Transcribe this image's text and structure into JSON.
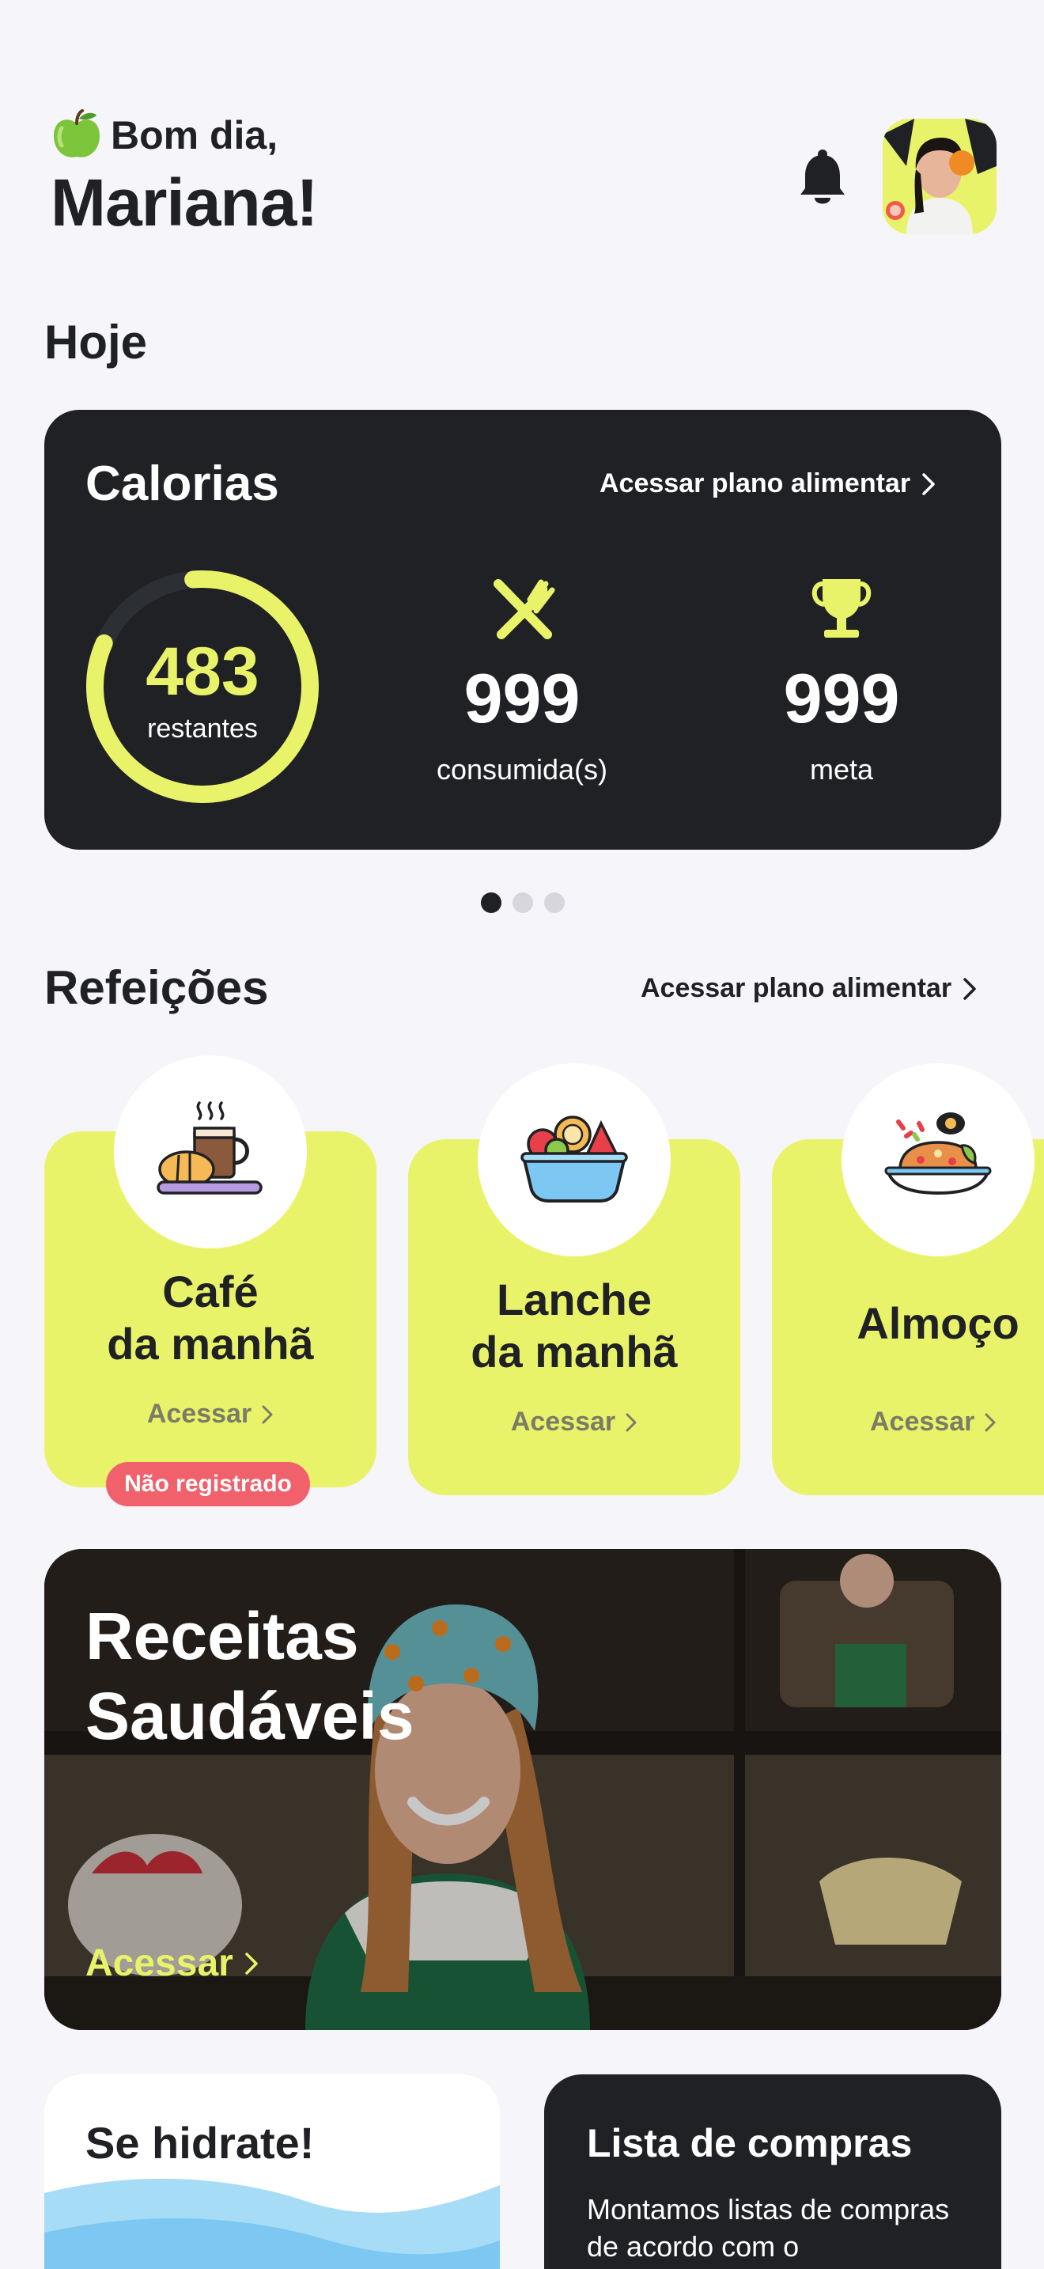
{
  "header": {
    "greeting": "Bom dia,",
    "name": "Mariana!",
    "greeting_icon": "green-apple-icon",
    "notification_icon": "bell-icon"
  },
  "today": {
    "section_title": "Hoje",
    "calories": {
      "title": "Calorias",
      "link": "Acessar plano alimentar",
      "remaining_value": "483",
      "remaining_label": "restantes",
      "remaining_fraction": 0.83,
      "consumed_value": "999",
      "consumed_label": "consumida(s)",
      "goal_value": "999",
      "goal_label": "meta"
    },
    "carousel": {
      "pages": 3,
      "active": 1
    }
  },
  "meals": {
    "section_title": "Refeições",
    "link": "Acessar plano alimentar",
    "items": [
      {
        "title_line1": "Café",
        "title_line2": "da manhã",
        "access": "Acessar",
        "badge": "Não registrado",
        "icon": "coffee-bread-icon"
      },
      {
        "title_line1": "Lanche",
        "title_line2": "da manhã",
        "access": "Acessar",
        "icon": "fruit-bowl-icon"
      },
      {
        "title_line1": "Almoço",
        "title_line2": "",
        "access": "Acessar",
        "icon": "lunch-plate-icon"
      }
    ]
  },
  "recipes": {
    "title_line1": "Receitas",
    "title_line2": "Saudáveis",
    "link": "Acessar"
  },
  "hydration": {
    "title": "Se hidrate!"
  },
  "shopping": {
    "title": "Lista de compras",
    "description": "Montamos listas de compras de acordo com o"
  },
  "colors": {
    "accent": "#e9f36a",
    "dark": "#1f2124",
    "background": "#f5f5fa",
    "badge": "#f0616b",
    "water": "#7cc8f2"
  }
}
